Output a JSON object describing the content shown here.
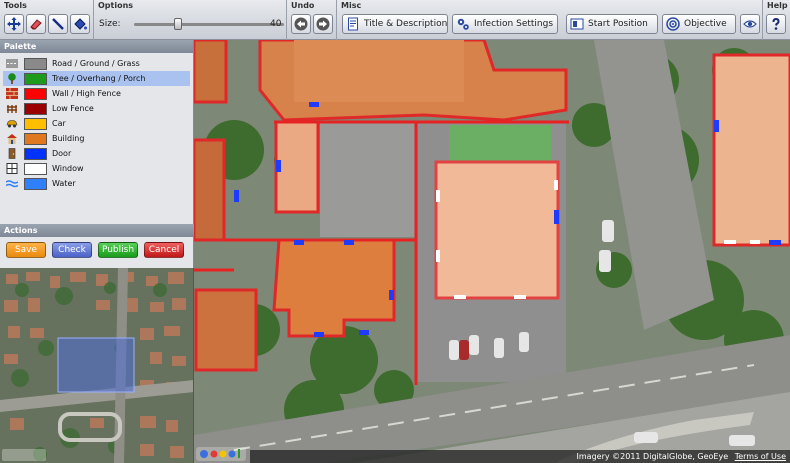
{
  "toolbar": {
    "tools_title": "Tools",
    "options_title": "Options",
    "size_label": "Size:",
    "size_value": "40",
    "undo_title": "Undo",
    "misc_title": "Misc",
    "help_title": "Help",
    "misc_buttons": {
      "title_desc": "Title & Description",
      "infection": "Infection Settings",
      "start": "Start Position",
      "objective": "Objective"
    }
  },
  "palette": {
    "title": "Palette",
    "items": [
      {
        "label": "Road / Ground / Grass",
        "color": "#8a8a8a",
        "icon": "road-icon"
      },
      {
        "label": "Tree / Overhang / Porch",
        "color": "#1e9a1e",
        "icon": "tree-icon"
      },
      {
        "label": "Wall / High Fence",
        "color": "#ff0000",
        "icon": "brick-wall-icon"
      },
      {
        "label": "Low Fence",
        "color": "#9a0000",
        "icon": "fence-icon"
      },
      {
        "label": "Car",
        "color": "#ffbf00",
        "icon": "car-icon"
      },
      {
        "label": "Building",
        "color": "#e07820",
        "icon": "house-icon"
      },
      {
        "label": "Door",
        "color": "#0033ff",
        "icon": "door-icon"
      },
      {
        "label": "Window",
        "color": "#ffffff",
        "icon": "window-icon"
      },
      {
        "label": "Water",
        "color": "#2f7fff",
        "icon": "water-icon"
      }
    ]
  },
  "actions": {
    "title": "Actions",
    "save": "Save",
    "check": "Check",
    "publish": "Publish",
    "cancel": "Cancel"
  },
  "map": {
    "attribution": "Imagery ©2011 DigitalGlobe, GeoEye",
    "terms": "Terms of Use"
  }
}
